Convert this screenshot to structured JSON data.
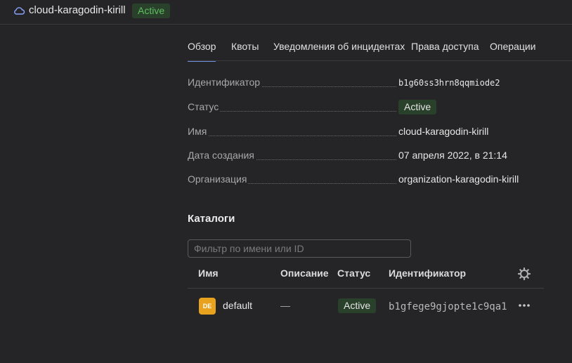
{
  "header": {
    "cloud_name": "cloud-karagodin-kirill",
    "status": "Active",
    "icon": "cloud-icon"
  },
  "tabs": [
    {
      "label": "Обзор",
      "active": true
    },
    {
      "label": "Квоты",
      "active": false
    },
    {
      "label": "Уведомления об инцидентах",
      "active": false
    },
    {
      "label": "Права доступа",
      "active": false
    },
    {
      "label": "Операции",
      "active": false
    }
  ],
  "properties": {
    "id_label": "Идентификатор",
    "id_value": "b1g60ss3hrn8qqmiode2",
    "status_label": "Статус",
    "status_value": "Active",
    "name_label": "Имя",
    "name_value": "cloud-karagodin-kirill",
    "created_label": "Дата создания",
    "created_value": "07 апреля 2022, в 21:14",
    "org_label": "Организация",
    "org_value": "organization-karagodin-kirill"
  },
  "catalogs": {
    "title": "Каталоги",
    "filter_placeholder": "Фильтр по имени или ID",
    "columns": {
      "name": "Имя",
      "description": "Описание",
      "status": "Статус",
      "id": "Идентификатор"
    },
    "rows": [
      {
        "avatar": "DE",
        "name": "default",
        "description": "—",
        "status": "Active",
        "id": "b1gfege9gjopte1c9qa1"
      }
    ]
  },
  "colors": {
    "background": "#252527",
    "accent": "#6f8fe0",
    "status_green": "#5fbf5f",
    "status_bg": "#29402a",
    "folder_avatar": "#e8a21d"
  }
}
